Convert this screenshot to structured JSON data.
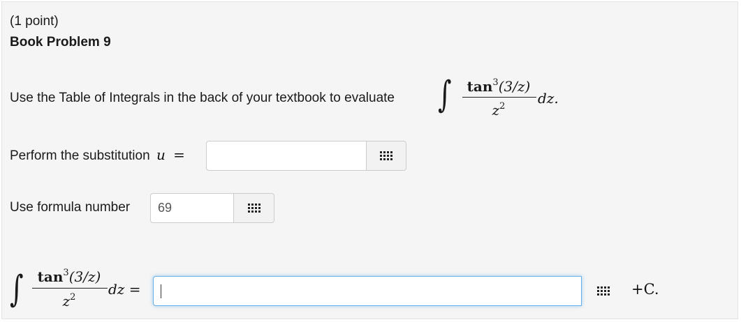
{
  "problem": {
    "points": "(1 point)",
    "title": "Book Problem 9",
    "prompt": "Use the Table of Integrals in the back of your textbook to evaluate",
    "integrand": {
      "numerator_func": "tan",
      "numerator_power": "3",
      "numerator_arg": "(3/z)",
      "denominator_var": "z",
      "denominator_power": "2",
      "differential": "dz.",
      "differential_final": "dz ="
    },
    "substitution_label": "Perform the substitution",
    "substitution_var": "u",
    "equals": "=",
    "formula_label": "Use formula number",
    "formula_value": "69",
    "constant": "+C."
  },
  "inputs": {
    "substitution_value": "",
    "answer_value": ""
  },
  "icons": {
    "palette": "equation-palette-icon",
    "integral": "integral-sign"
  },
  "colors": {
    "panel_bg": "#f5f5f5",
    "field_border": "#cccccc",
    "focus_border": "#66afe9"
  }
}
